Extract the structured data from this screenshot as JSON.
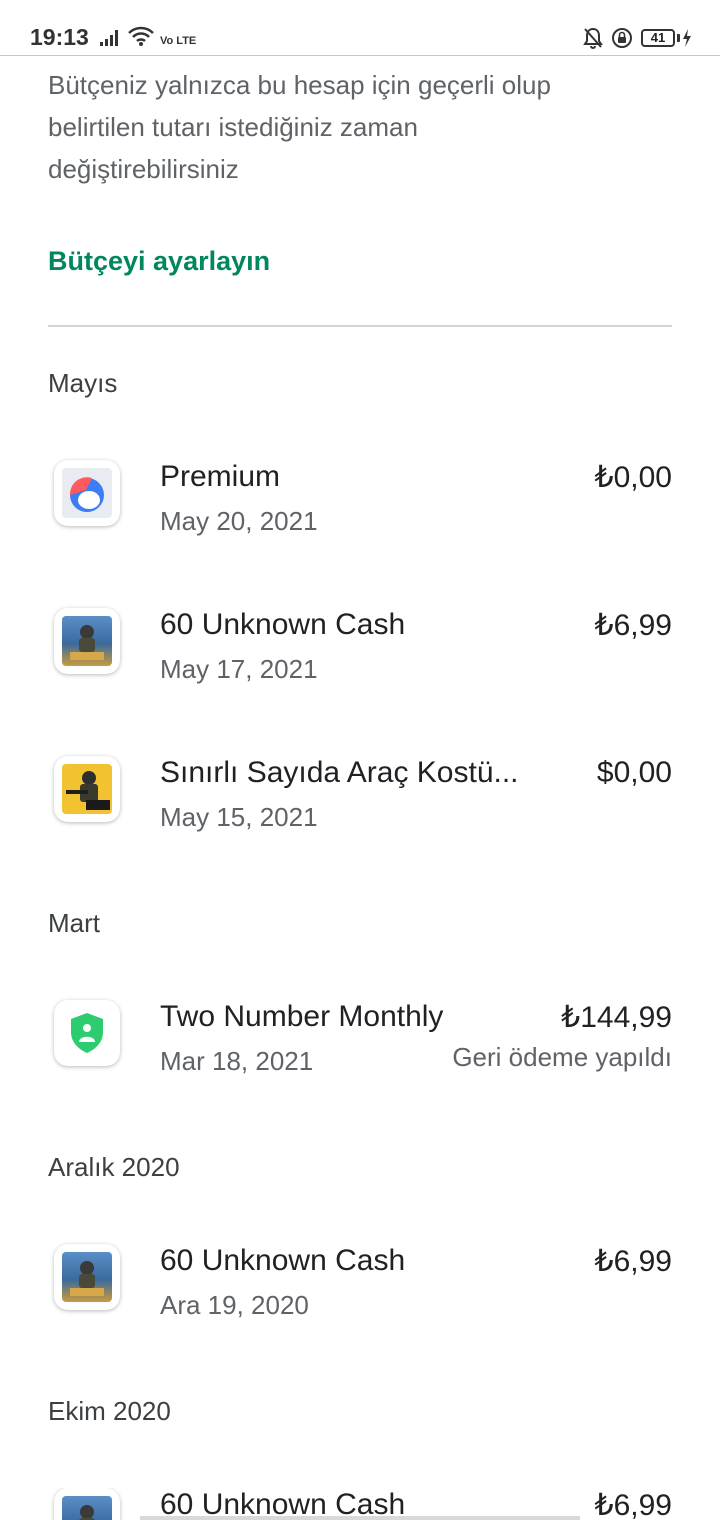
{
  "status_bar": {
    "time": "19:13",
    "network_label": "Vo LTE",
    "battery_level": "41"
  },
  "intro_text": "Bütçeniz yalnızca bu hesap için geçerli olup belirtilen tutarı istediğiniz zaman değiştirebilirsiniz",
  "budget_link": "Bütçeyi ayarlayın",
  "colors": {
    "accent": "#01875f",
    "secondary_text": "#5f6368"
  },
  "sections": [
    {
      "month": "Mayıs",
      "items": [
        {
          "icon": "faceapp-icon",
          "title": "Premium",
          "date": "May 20, 2021",
          "price": "₺0,00",
          "status": ""
        },
        {
          "icon": "pubg-mobile-icon",
          "title": "60 Unknown Cash",
          "date": "May 17, 2021",
          "price": "₺6,99",
          "status": ""
        },
        {
          "icon": "pubg-new-state-icon",
          "title": "Sınırlı Sayıda Araç Kostü...",
          "date": "May 15, 2021",
          "price": "$0,00",
          "status": ""
        }
      ]
    },
    {
      "month": "Mart",
      "items": [
        {
          "icon": "shield-app-icon",
          "title": "Two Number Monthly",
          "date": "Mar 18, 2021",
          "price": "₺144,99",
          "status": "Geri ödeme yapıldı"
        }
      ]
    },
    {
      "month": "Aralık 2020",
      "items": [
        {
          "icon": "pubg-mobile-icon",
          "title": "60 Unknown Cash",
          "date": "Ara 19, 2020",
          "price": "₺6,99",
          "status": ""
        }
      ]
    },
    {
      "month": "Ekim 2020",
      "items": [
        {
          "icon": "pubg-mobile-icon",
          "title": "60 Unknown Cash",
          "date": "",
          "price": "₺6,99",
          "status": ""
        }
      ]
    }
  ]
}
